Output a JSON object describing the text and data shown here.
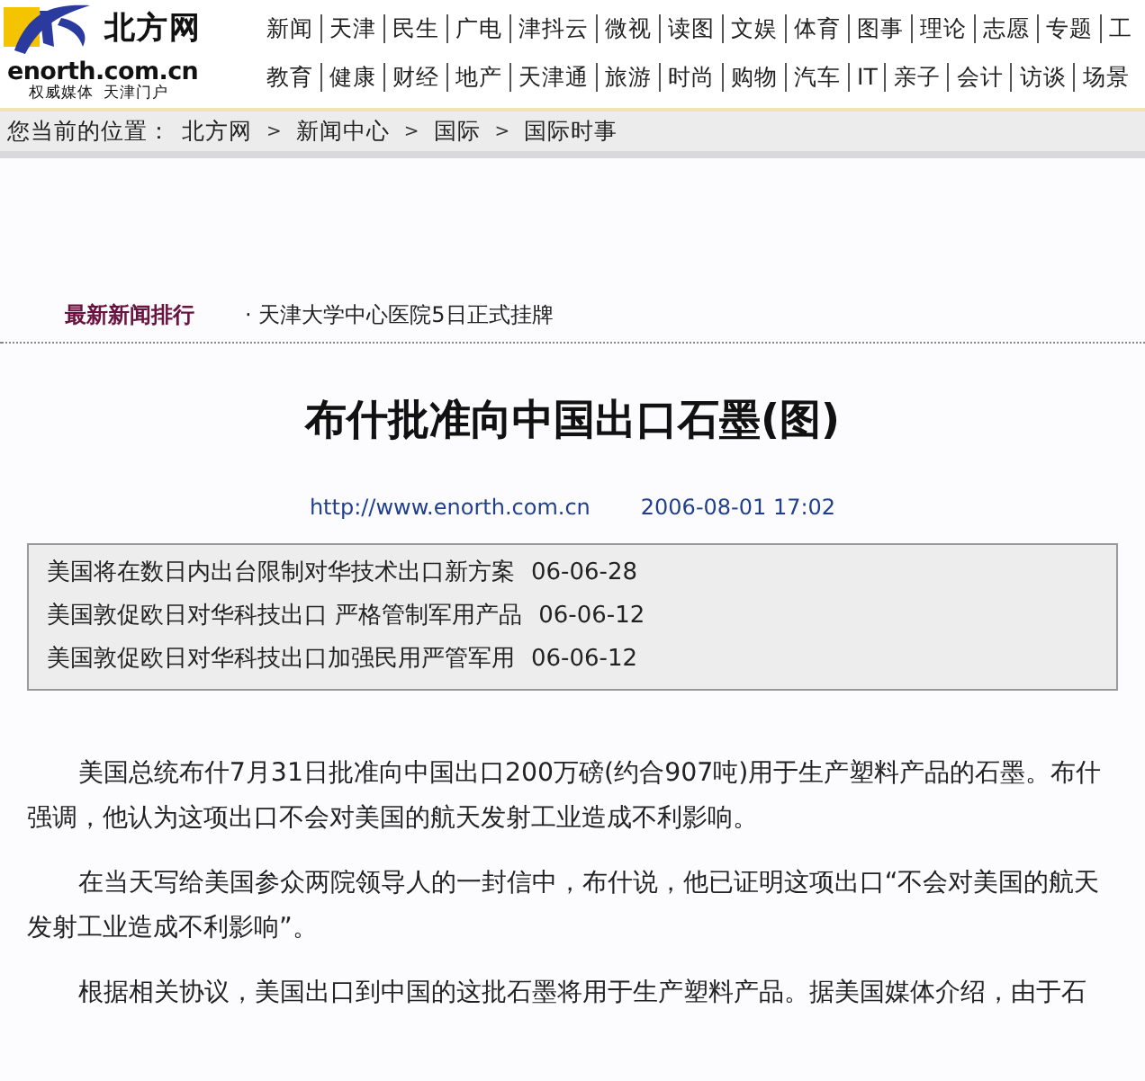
{
  "logo": {
    "name": "北方网",
    "domain": "enorth.com.cn",
    "slogan": "权威媒体  天津门户"
  },
  "nav_rows": [
    [
      "新闻",
      "天津",
      "民生",
      "广电",
      "津抖云",
      "微视",
      "读图",
      "文娱",
      "体育",
      "图事",
      "理论",
      "志愿",
      "专题",
      "工"
    ],
    [
      "教育",
      "健康",
      "财经",
      "地产",
      "天津通",
      "旅游",
      "时尚",
      "购物",
      "汽车",
      "IT",
      "亲子",
      "会计",
      "访谈",
      "场景"
    ]
  ],
  "breadcrumb": {
    "label": "您当前的位置：",
    "items": [
      "北方网",
      "新闻中心",
      "国际",
      "国际时事"
    ],
    "separator": ">"
  },
  "ranking": {
    "title": "最新新闻排行",
    "items": [
      "· 天津大学中心医院5日正式挂牌"
    ]
  },
  "article": {
    "title": "布什批准向中国出口石墨(图)",
    "source": "http://www.enorth.com.cn",
    "date": "2006-08-01 17:02",
    "related": [
      {
        "title": "美国将在数日内出台限制对华技术出口新方案",
        "date": "06-06-28"
      },
      {
        "title": "美国敦促欧日对华科技出口 严格管制军用产品",
        "date": "06-06-12"
      },
      {
        "title": "美国敦促欧日对华科技出口加强民用严管军用",
        "date": "06-06-12"
      }
    ],
    "paragraphs": [
      "美国总统布什7月31日批准向中国出口200万磅(约合907吨)用于生产塑料产品的石墨。布什强调，他认为这项出口不会对美国的航天发射工业造成不利影响。",
      "在当天写给美国参众两院领导人的一封信中，布什说，他已证明这项出口“不会对美国的航天发射工业造成不利影响”。",
      "根据相关协议，美国出口到中国的这批石墨将用于生产塑料产品。据美国媒体介绍，由于石"
    ]
  }
}
